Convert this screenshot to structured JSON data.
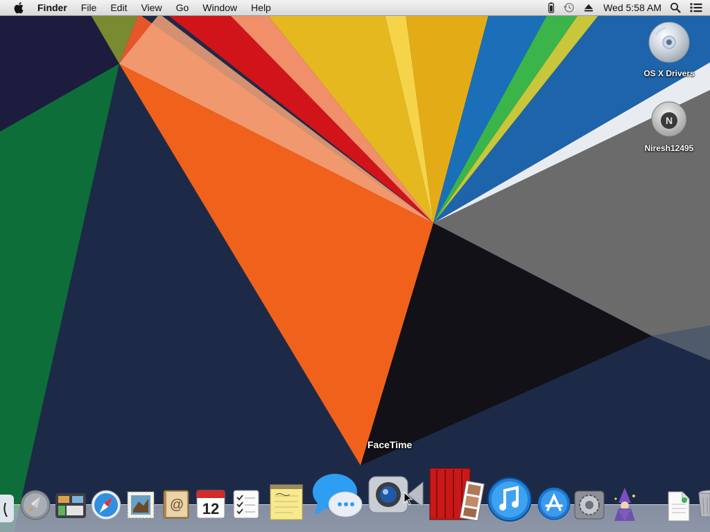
{
  "menubar": {
    "app_name": "Finder",
    "menus": [
      "File",
      "Edit",
      "View",
      "Go",
      "Window",
      "Help"
    ],
    "clock": "Wed 5:58 AM"
  },
  "desktop_icons": [
    {
      "label": "OS X Drivers",
      "icon": "dvd-disc-icon"
    },
    {
      "label": "Niresh12495",
      "icon": "hard-drive-icon"
    }
  ],
  "dock": {
    "tooltip": "FaceTime",
    "items": [
      "Finder",
      "Launchpad",
      "Mission Control",
      "Safari",
      "Mail",
      "Contacts",
      "Calendar",
      "Reminders",
      "Notes",
      "Messages",
      "FaceTime",
      "Photo Booth",
      "iTunes",
      "App Store",
      "System Preferences",
      "Wizard",
      "Document",
      "Trash"
    ]
  },
  "calendar_day": "12",
  "colors": {
    "navy": "#1d2a47",
    "orange": "#f0611c",
    "yellow": "#e5b820",
    "red": "#d0141a",
    "blue": "#1a6fb8",
    "green": "#0d7a3c"
  }
}
